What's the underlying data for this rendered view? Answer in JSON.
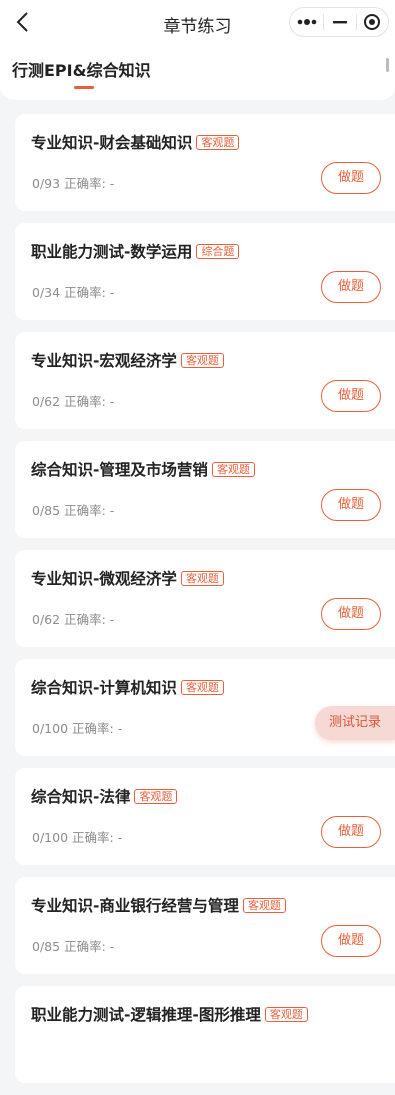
{
  "header": {
    "title": "章节练习"
  },
  "tabs": [
    {
      "label": "行测EPI&综合知识",
      "active": true
    }
  ],
  "colors": {
    "accent": "#e8613d",
    "background": "#f4f5f7"
  },
  "stats_labels": {
    "accuracy": "正确率:"
  },
  "items": [
    {
      "title": "专业知识-财会基础知识",
      "badge": "客观题",
      "progress": "0/93",
      "accuracy": "-",
      "action": "做题"
    },
    {
      "title": "职业能力测试-数学运用",
      "badge": "综合题",
      "progress": "0/34",
      "accuracy": "-",
      "action": "做题"
    },
    {
      "title": "专业知识-宏观经济学",
      "badge": "客观题",
      "progress": "0/62",
      "accuracy": "-",
      "action": "做题"
    },
    {
      "title": "综合知识-管理及市场营销",
      "badge": "客观题",
      "progress": "0/85",
      "accuracy": "-",
      "action": "做题"
    },
    {
      "title": "专业知识-微观经济学",
      "badge": "客观题",
      "progress": "0/62",
      "accuracy": "-",
      "action": "做题"
    },
    {
      "title": "综合知识-计算机知识",
      "badge": "客观题",
      "progress": "0/100",
      "accuracy": "-",
      "action": "测试记录"
    },
    {
      "title": "综合知识-法律",
      "badge": "客观题",
      "progress": "0/100",
      "accuracy": "-",
      "action": "做题"
    },
    {
      "title": "专业知识-商业银行经营与管理",
      "badge": "客观题",
      "progress": "0/85",
      "accuracy": "-",
      "action": "做题"
    },
    {
      "title": "职业能力测试-逻辑推理-图形推理",
      "badge": "客观题",
      "progress": "",
      "accuracy": "",
      "action": ""
    }
  ]
}
